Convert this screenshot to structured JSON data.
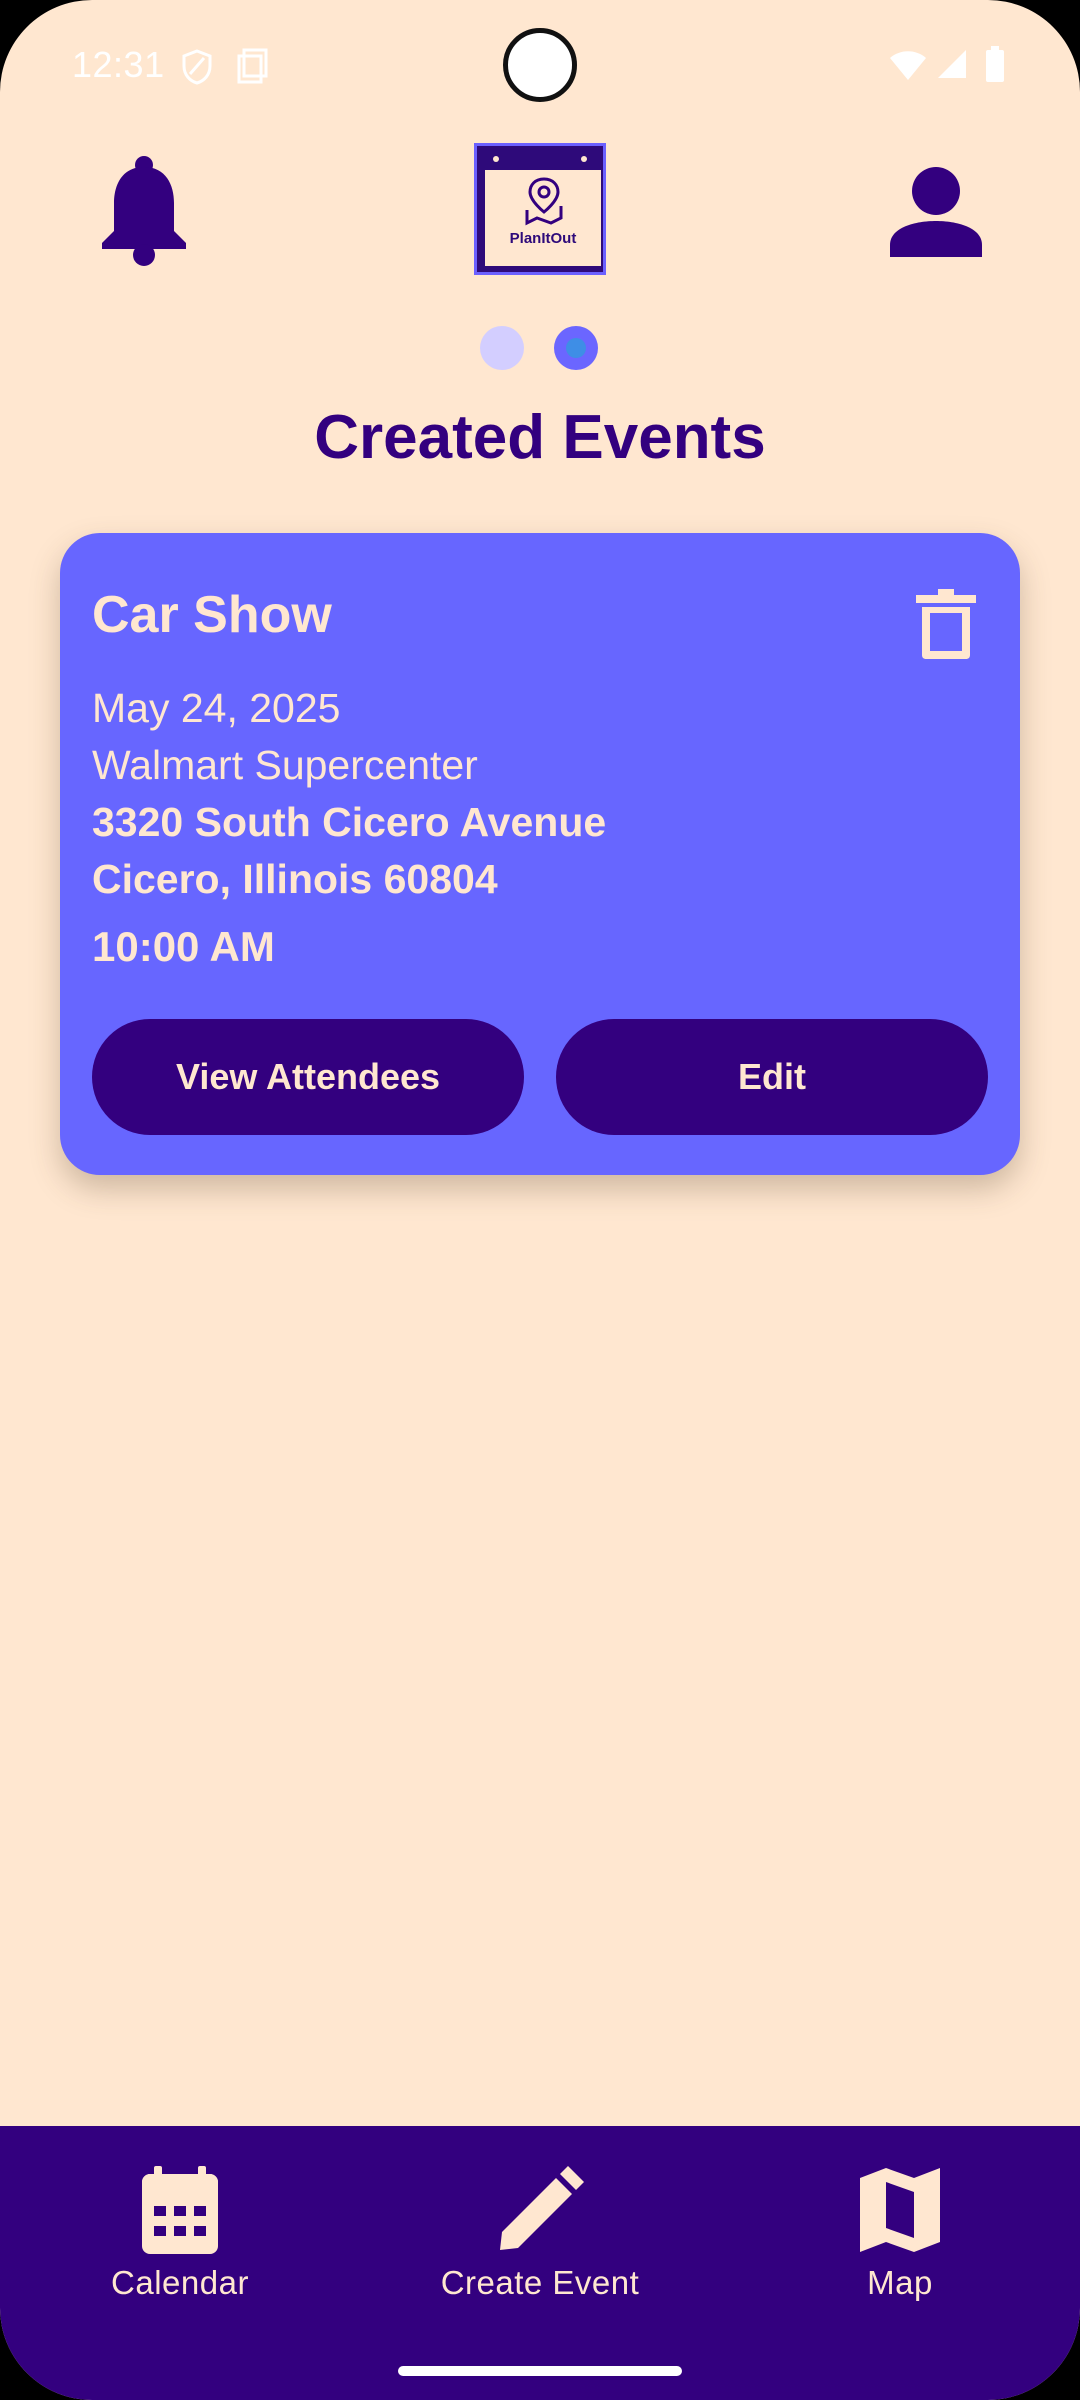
{
  "status_bar": {
    "time": "12:31",
    "icons": [
      "shield-icon",
      "screenshot-icon",
      "wifi-icon",
      "cellular-signal-icon",
      "battery-icon"
    ]
  },
  "header": {
    "left_icon": "bell-icon",
    "logo_text": "PlanItOut",
    "right_icon": "profile-icon",
    "page_indicator": {
      "count": 2,
      "active": 2
    }
  },
  "page_title": "Created Events",
  "events": [
    {
      "title": "Car Show",
      "date": "May 24, 2025",
      "venue": "Walmart Supercenter",
      "address_line1": "3320 South Cicero Avenue",
      "address_line2": "Cicero, Illinois 60804",
      "time": "10:00 AM",
      "delete_icon": "trash-icon",
      "view_attendees_label": "View Attendees",
      "edit_label": "Edit"
    }
  ],
  "bottom_nav": [
    {
      "label": "Calendar",
      "icon": "calendar-icon"
    },
    {
      "label": "Create Event",
      "icon": "pencil-icon"
    },
    {
      "label": "Map",
      "icon": "map-icon"
    }
  ],
  "colors": {
    "background": "#FFE7D0",
    "primary": "#33007F",
    "card": "#6766FF",
    "on_card": "#FFE7D0"
  }
}
